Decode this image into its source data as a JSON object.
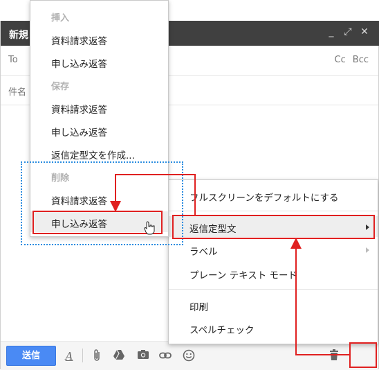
{
  "compose": {
    "title": "新規",
    "window_controls": [
      "_",
      "⤢",
      "✕"
    ],
    "to_label": "To",
    "cc_label": "Cc",
    "bcc_label": "Bcc",
    "subject_label": "件名"
  },
  "toolbar": {
    "send_label": "送信",
    "format_icon": "A",
    "icons": [
      "paperclip-icon",
      "drive-icon",
      "camera-icon",
      "link-icon",
      "emoji-icon",
      "trash-icon",
      "caret-down-icon"
    ]
  },
  "canned_menu": {
    "insert_header": "挿入",
    "insert_items": [
      "資料請求返答",
      "申し込み返答"
    ],
    "save_header": "保存",
    "save_items": [
      "資料請求返答",
      "申し込み返答",
      "返信定型文を作成..."
    ],
    "delete_header": "削除",
    "delete_items": [
      "資料請求返答",
      "申し込み返答"
    ]
  },
  "more_menu": {
    "items": [
      {
        "label": "フルスクリーンをデフォルトにする"
      },
      {
        "label": "返信定型文"
      },
      {
        "label": "ラベル"
      },
      {
        "label": "プレーン テキスト モード"
      },
      {
        "label": "印刷"
      },
      {
        "label": "スペルチェック"
      }
    ]
  },
  "colors": {
    "title_bar": "#404040",
    "send_button": "#4a8af4",
    "annotation_red": "#e02020",
    "annotation_blue": "#2a8ce0"
  }
}
